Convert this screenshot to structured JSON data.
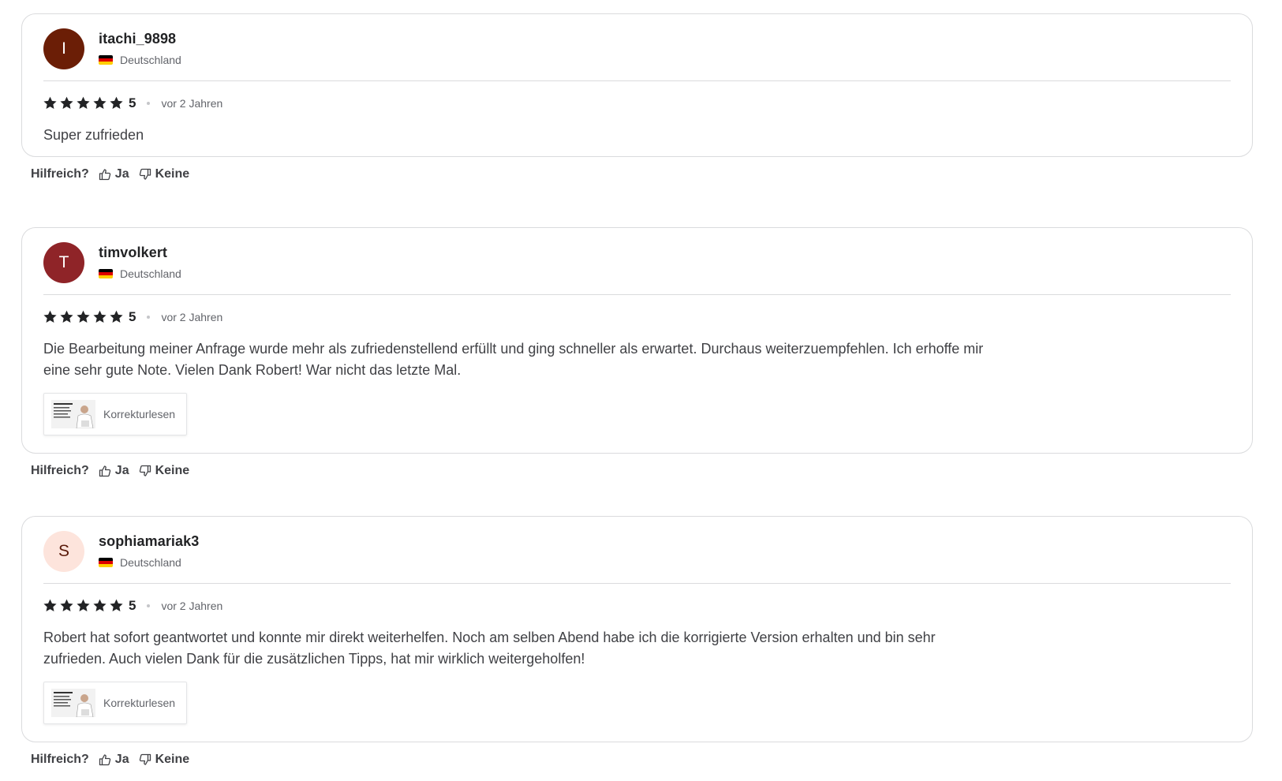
{
  "reviews": [
    {
      "avatar_letter": "I",
      "avatar_bg": "#6b1e06",
      "avatar_fg": "#ffffff",
      "username": "itachi_9898",
      "country": "Deutschland",
      "rating": "5",
      "time": "vor 2 Jahren",
      "text": "Super zufrieden",
      "helpful_label": "Hilfreich?",
      "yes_label": "Ja",
      "no_label": "Keine"
    },
    {
      "avatar_letter": "T",
      "avatar_bg": "#8f2428",
      "avatar_fg": "#ffffff",
      "username": "timvolkert",
      "country": "Deutschland",
      "rating": "5",
      "time": "vor 2 Jahren",
      "text": "Die Bearbeitung meiner Anfrage wurde mehr als zufriedenstellend erfüllt und ging schneller als erwartet. Durchaus weiterzuempfehlen. Ich erhoffe mir eine sehr gute Note. Vielen Dank Robert! War nicht das letzte Mal.",
      "gig_label": "Korrekturlesen",
      "helpful_label": "Hilfreich?",
      "yes_label": "Ja",
      "no_label": "Keine"
    },
    {
      "avatar_letter": "S",
      "avatar_bg": "#fde4dc",
      "avatar_fg": "#5a1a0a",
      "username": "sophiamariak3",
      "country": "Deutschland",
      "rating": "5",
      "time": "vor 2 Jahren",
      "text": "Robert hat sofort geantwortet und konnte mir direkt weiterhelfen. Noch am selben Abend habe ich die korrigierte Version erhalten und bin sehr zufrieden. Auch vielen Dank für die zusätzlichen Tipps, hat mir wirklich weitergeholfen!",
      "gig_label": "Korrekturlesen",
      "helpful_label": "Hilfreich?",
      "yes_label": "Ja",
      "no_label": "Keine"
    }
  ],
  "colors": {
    "star": "#222325",
    "border": "#dadbdd",
    "muted_text": "#62646a"
  },
  "icons": {
    "star": "star-icon",
    "flag": "germany-flag-icon",
    "thumbs_up": "thumbs-up-icon",
    "thumbs_down": "thumbs-down-icon"
  }
}
